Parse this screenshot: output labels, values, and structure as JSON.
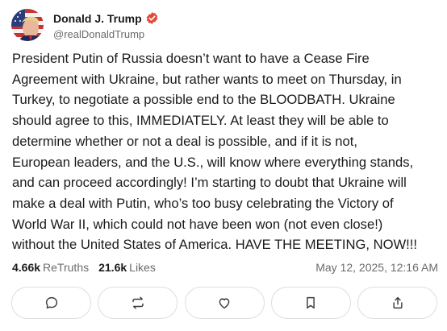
{
  "author": {
    "display_name": "Donald J. Trump",
    "handle": "@realDonaldTrump",
    "verified_icon": "verified-badge-icon",
    "avatar_icon": "profile-avatar"
  },
  "post": {
    "lines": [
      "President Putin of Russia doesn’t want to have a Cease Fire",
      "Agreement with Ukraine, but rather wants to meet on Thursday, in",
      "Turkey, to negotiate a possible end to the BLOODBATH. Ukraine",
      "should agree to this, IMMEDIATELY. At least they will be able to",
      "determine whether or not a deal is possible, and if it is not,",
      "European leaders, and the U.S., will know where everything stands,",
      "and can proceed accordingly! I’m starting to doubt that Ukraine will",
      "make a deal with Putin, who’s too busy celebrating the Victory of",
      "World War II, which could not have been won (not even close!)",
      "without the United States of America. HAVE THE MEETING, NOW!!!"
    ]
  },
  "stats": {
    "retruths_count": "4.66k",
    "retruths_label": "ReTruths",
    "likes_count": "21.6k",
    "likes_label": "Likes",
    "timestamp": "May 12, 2025, 12:16 AM"
  },
  "actions": [
    {
      "icon": "reply-icon"
    },
    {
      "icon": "retruth-icon"
    },
    {
      "icon": "like-icon"
    },
    {
      "icon": "bookmark-icon"
    },
    {
      "icon": "share-icon"
    }
  ],
  "colors": {
    "verified": "#e24a3b",
    "text": "#1a1a1a",
    "muted": "#6b6b6b",
    "border": "#dedede",
    "icon": "#3a3a3a"
  }
}
